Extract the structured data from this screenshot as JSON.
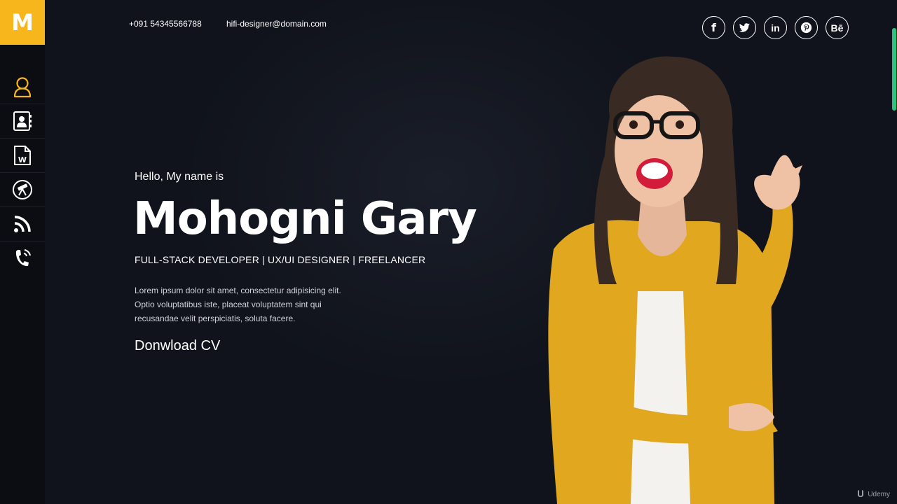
{
  "brand": {
    "logo_letter": "M",
    "accent_color": "#f7b61c"
  },
  "contact": {
    "phone": "+091 54345566788",
    "email": "hifi-designer@domain.com"
  },
  "sidebar": {
    "items": [
      {
        "icon": "user-icon",
        "active": true
      },
      {
        "icon": "contact-card-icon",
        "active": false
      },
      {
        "icon": "word-document-icon",
        "active": false
      },
      {
        "icon": "telescope-icon",
        "active": false
      },
      {
        "icon": "rss-icon",
        "active": false
      },
      {
        "icon": "phone-icon",
        "active": false
      }
    ]
  },
  "social": [
    {
      "icon": "facebook-icon",
      "glyph": "f"
    },
    {
      "icon": "twitter-icon",
      "glyph": ""
    },
    {
      "icon": "linkedin-icon",
      "glyph": "in"
    },
    {
      "icon": "pinterest-icon",
      "glyph": ""
    },
    {
      "icon": "behance-icon",
      "glyph": "Bē"
    }
  ],
  "hero": {
    "greeting": "Hello, My name is",
    "name": "Mohogni Gary",
    "roles": "FULL-STACK DEVELOPER | UX/UI DESIGNER | FREELANCER",
    "bio_lines": [
      "Lorem ipsum dolor sit amet, consectetur adipisicing elit.",
      "Optio voluptatibus iste, placeat voluptatem sint qui",
      "recusandae velit perspiciatis, soluta facere."
    ],
    "cta": "Donwload CV"
  },
  "watermark": "Udemy"
}
